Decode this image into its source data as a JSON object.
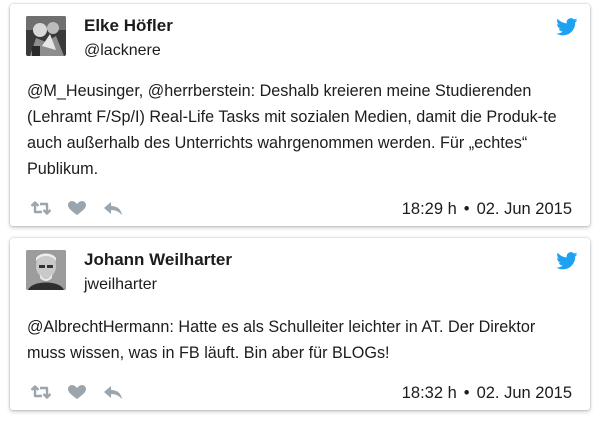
{
  "colors": {
    "twitter_blue": "#1da1f2",
    "action_gray": "#9aa5ae",
    "text": "#1c1c1c"
  },
  "tweets": [
    {
      "author": "Elke Höfler",
      "handle": "@lacknere",
      "text": "@M_Heusinger, @herrberstein: Deshalb kreieren meine Studierenden (Lehramt F/Sp/I) Real-Life Tasks mit sozialen Medien, damit die Produk-te auch außerhalb des Unterrichts wahrgenommen werden. Für „echtes“ Publikum.",
      "time": "18:29 h",
      "date": "02. Jun 2015",
      "separator": "•",
      "icons": [
        "retweet-icon",
        "like-icon",
        "reply-icon",
        "twitter-bird-icon"
      ]
    },
    {
      "author": "Johann Weilharter",
      "handle": "jweilharter",
      "text": "@AlbrechtHermann: Hatte es als Schulleiter leichter in AT. Der Direktor muss wissen, was in FB läuft. Bin aber für BLOGs!",
      "time": "18:32 h",
      "date": "02. Jun 2015",
      "separator": "•",
      "icons": [
        "retweet-icon",
        "like-icon",
        "reply-icon",
        "twitter-bird-icon"
      ]
    }
  ]
}
